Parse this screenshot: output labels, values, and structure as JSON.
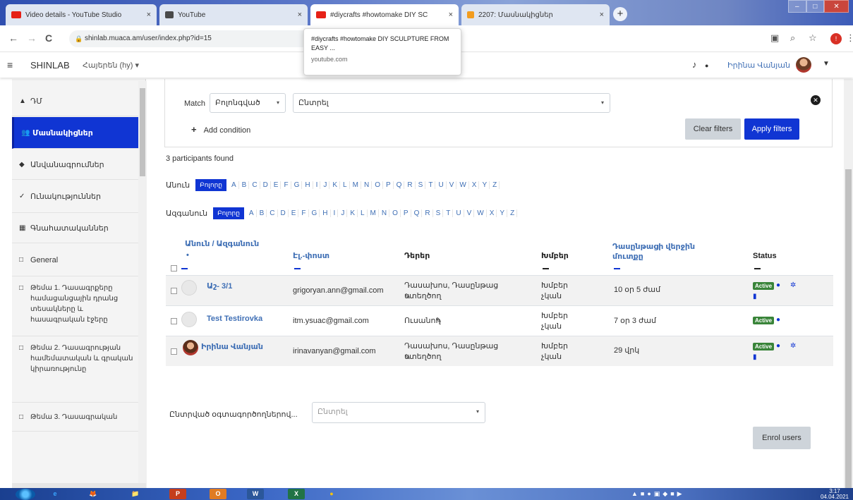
{
  "browser": {
    "tabs": [
      {
        "label": "Video details - YouTube Studio",
        "favicon_color": "#e62117",
        "active": false
      },
      {
        "label": "YouTube",
        "favicon_color": "#4a4a4a",
        "active": false
      },
      {
        "label": "#diycrafts #howtomake DIY SC",
        "favicon_color": "#e62117",
        "active": true
      },
      {
        "label": "2207: Մասնակիցներ",
        "favicon_color": "#f29c1f",
        "active": false
      }
    ],
    "tab_glyphs": {
      "close": "×",
      "new_tab": "+"
    },
    "url": "shinlab.muaca.am/user/index.php?id=15",
    "tooltip": {
      "title": "#diycrafts #howtomake DIY SCULPTURE FROM EASY ...",
      "domain": "youtube.com"
    }
  },
  "navbar": {
    "brand": "SHINLAB",
    "language": "Հայերեն (hy) ▾",
    "username": "Իրինա Վանյան"
  },
  "drawer": {
    "items": [
      {
        "label": "ԴՄ",
        "icon": "mortarboard-icon",
        "glyph": "▲"
      },
      {
        "label": "Մասնակիցներ",
        "icon": "users-icon",
        "glyph": "👥",
        "active": true
      },
      {
        "label": "Անվանագրումներ",
        "icon": "shield-icon",
        "glyph": "◆"
      },
      {
        "label": "Ունակություններ",
        "icon": "check-icon",
        "glyph": "✓"
      },
      {
        "label": "Գնահատականներ",
        "icon": "table-icon",
        "glyph": "▦"
      },
      {
        "label": "General",
        "icon": "folder-icon",
        "glyph": "□"
      },
      {
        "label": "Թեմա 1. Դասագրքերը համացանցային դրանց տեսակները և հասագրական էջերը",
        "icon": "folder-icon",
        "glyph": "□"
      },
      {
        "label": "Թեմա 2. Դասագրության համեմատական և գրական կիրառությունը",
        "icon": "folder-icon",
        "glyph": "□"
      },
      {
        "label": "Թեմա 3. Դասագրական",
        "icon": "folder-icon",
        "glyph": "□"
      }
    ]
  },
  "filters": {
    "match_label": "Match",
    "match_value": "Բոլոնգված",
    "condition_value": "Ընտրել",
    "add_condition": "Add condition",
    "clear_filters": "Clear filters",
    "apply_filters": "Apply filters"
  },
  "participants_found": "3 participants found",
  "initials": {
    "first_label": "Անուն",
    "last_label": "Ազգանուն",
    "all_label": "Բոլորը",
    "letters": [
      "A",
      "B",
      "C",
      "D",
      "E",
      "F",
      "G",
      "H",
      "I",
      "J",
      "K",
      "L",
      "M",
      "N",
      "O",
      "P",
      "Q",
      "R",
      "S",
      "T",
      "U",
      "V",
      "W",
      "X",
      "Y",
      "Z"
    ]
  },
  "table": {
    "headers": {
      "name": "Անուն / Ազգանուն",
      "email": "Էլ.-փոստ",
      "roles": "Դերեր",
      "groups": "Խմբեր",
      "last_access": "Դասընթացի վերջին մուտքը",
      "status": "Status"
    },
    "rows": [
      {
        "name": "Աշ- 3/1",
        "email": "grigoryan.ann@gmail.com",
        "roles": "Դասախոս, Դասընթաց ստեղծող",
        "groups": "Խմբեր չկան",
        "last_access": "10 օր 5 ժամ",
        "status": "Active",
        "photo": false
      },
      {
        "name": "Test Testirovka",
        "email": "itm.ysuac@gmail.com",
        "roles": "Ուսանող",
        "groups": "Խմբեր չկան",
        "last_access": "7 օր 3 ժամ",
        "status": "Active",
        "photo": false
      },
      {
        "name": "Իրինա Վանյան",
        "email": "irinavanyan@gmail.com",
        "roles": "Դասախոս, Դասընթաց ստեղծող",
        "groups": "Խմբեր չկան",
        "last_access": "29 վրկ",
        "status": "Active",
        "photo": true
      }
    ]
  },
  "bulk": {
    "label": "Ընտրված օգտագործողներով...",
    "select_value": "Ընտրել"
  },
  "enrol_users": "Enrol users",
  "taskbar": {
    "apps": [
      "e",
      "🦊",
      "📁",
      "P",
      "O",
      "W",
      "X",
      "●"
    ],
    "clock_time": "3:17",
    "clock_date": "04.04.2021"
  },
  "colors": {
    "accent": "#1035d3",
    "link": "#3f6fb5",
    "active_badge": "#398439"
  }
}
